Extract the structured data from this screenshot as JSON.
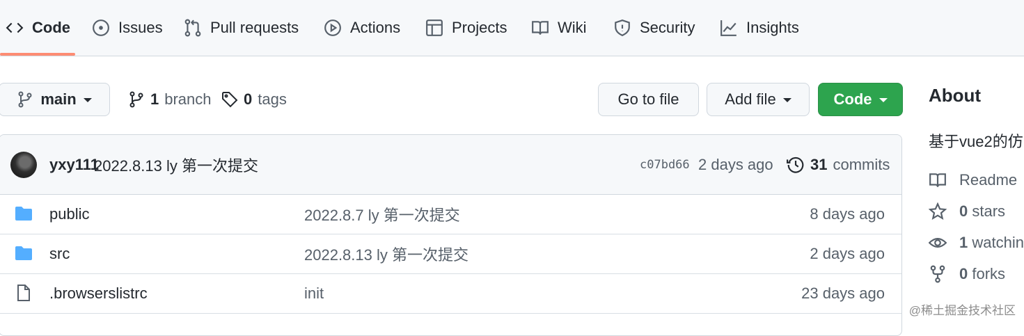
{
  "colors": {
    "accent_underline": "#fd8c73",
    "primary_button": "#2da44e",
    "folder_icon": "#54aeff",
    "muted_text": "#57606a"
  },
  "nav": {
    "tabs": [
      {
        "label": "Code",
        "icon": "code-icon",
        "active": true
      },
      {
        "label": "Issues",
        "icon": "issue-opened-icon"
      },
      {
        "label": "Pull requests",
        "icon": "git-pull-request-icon"
      },
      {
        "label": "Actions",
        "icon": "play-icon"
      },
      {
        "label": "Projects",
        "icon": "table-icon"
      },
      {
        "label": "Wiki",
        "icon": "book-icon"
      },
      {
        "label": "Security",
        "icon": "shield-icon"
      },
      {
        "label": "Insights",
        "icon": "graph-icon"
      }
    ]
  },
  "toolbar": {
    "branch_select": "main",
    "branch_count": "1",
    "branch_label": "branch",
    "tag_count": "0",
    "tag_label": "tags",
    "go_to_file": "Go to file",
    "add_file": "Add file",
    "code": "Code"
  },
  "latest_commit": {
    "author": "yxy111",
    "message": "2022.8.13 ly 第一次提交",
    "sha": "c07bd66",
    "time": "2 days ago",
    "commit_count": "31",
    "commit_label": "commits"
  },
  "files": [
    {
      "type": "folder",
      "icon": "folder-icon",
      "name": "public",
      "message": "2022.8.7 ly 第一次提交",
      "time": "8 days ago"
    },
    {
      "type": "folder",
      "icon": "folder-icon",
      "name": "src",
      "message": "2022.8.13 ly 第一次提交",
      "time": "2 days ago"
    },
    {
      "type": "file",
      "icon": "file-icon",
      "name": ".browserslistrc",
      "message": "init",
      "time": "23 days ago"
    }
  ],
  "about": {
    "title": "About",
    "description": "基于vue2的仿",
    "readme": "Readme",
    "stars_count": "0",
    "stars_label": "stars",
    "watching_count": "1",
    "watching_label": "watching",
    "forks_count": "0",
    "forks_label": "forks"
  },
  "watermark": "@稀土掘金技术社区"
}
